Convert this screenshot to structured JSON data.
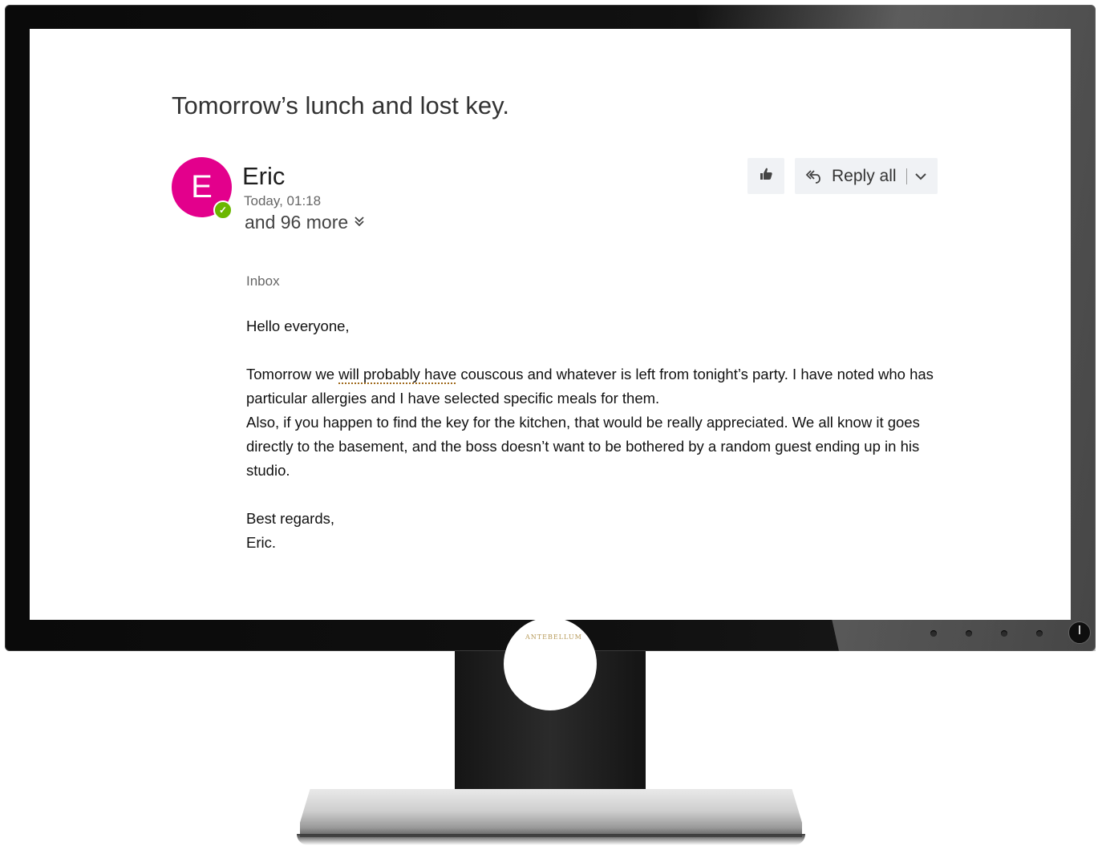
{
  "email": {
    "subject": "Tomorrow’s lunch and lost key.",
    "sender": {
      "initial": "E",
      "name": "Eric",
      "timestamp": "Today, 01:18",
      "more_recipients": "and 96 more",
      "avatar_color": "#e3008c",
      "presence_color": "#6bb700"
    },
    "actions": {
      "like_icon": "thumbs-up-icon",
      "reply_all_label": "Reply all",
      "reply_all_icon": "reply-all-icon"
    },
    "folder": "Inbox",
    "body": {
      "greeting": "Hello everyone,",
      "para1_a": "Tomorrow we ",
      "para1_flagged": "will probably have",
      "para1_b": " couscous and whatever is left from tonight’s party. I have noted who has particular allergies and I have selected specific meals for them.",
      "para2": "Also, if you happen to find the key for the kitchen, that would be really appreciated. We all know it goes directly to the basement, and the boss doesn’t want to be bothered by a random guest ending up in his studio.",
      "signoff": "Best regards,",
      "signature": "Eric."
    }
  },
  "monitor": {
    "brand": "ANTEBELLUM"
  }
}
